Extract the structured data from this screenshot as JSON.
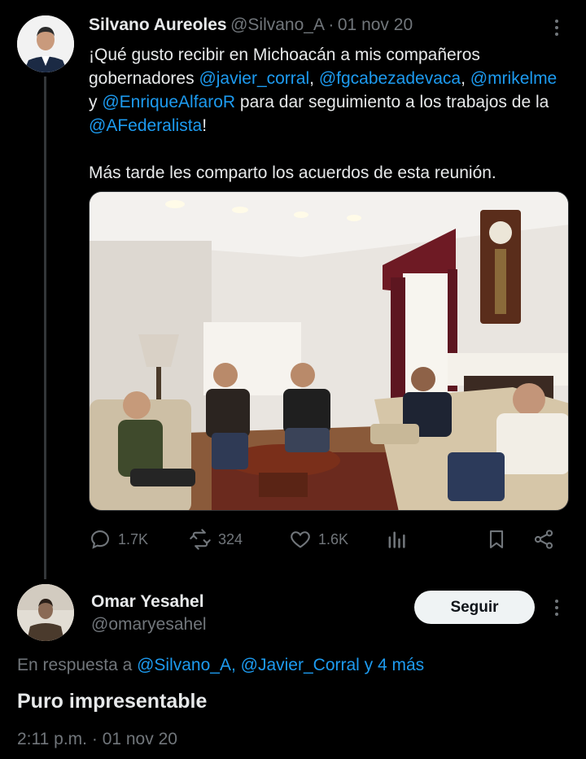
{
  "parent_tweet": {
    "author_name": "Silvano Aureoles",
    "author_handle": "@Silvano_A",
    "separator": "·",
    "date": "01 nov 20",
    "text_parts": {
      "t1": "¡Qué gusto recibir en Michoacán a mis compañeros gobernadores ",
      "m1": "@javier_corral",
      "t2": ", ",
      "m2": "@fgcabezadevaca",
      "t3": ", ",
      "m3": "@mrikelme",
      "t4": " y ",
      "m4": "@EnriqueAlfaroR",
      "t5": " para dar seguimiento a los trabajos de la ",
      "m5": "@AFederalista",
      "t6": "!",
      "p2": "Más tarde les comparto los acuerdos de esta reunión."
    },
    "stats": {
      "replies": "1.7K",
      "retweets": "324",
      "likes": "1.6K"
    }
  },
  "reply": {
    "author_name": "Omar Yesahel",
    "author_handle": "@omaryesahel",
    "follow_label": "Seguir",
    "reply_prefix": "En respuesta a ",
    "reply_mentions": "@Silvano_A, @Javier_Corral y 4 más",
    "text": "Puro impresentable",
    "time": "2:11 p.m.",
    "separator": "·",
    "date": "01 nov 20"
  },
  "colors": {
    "background": "#000000",
    "text": "#e7e9ea",
    "secondary": "#71767b",
    "link": "#1d9bf0"
  }
}
